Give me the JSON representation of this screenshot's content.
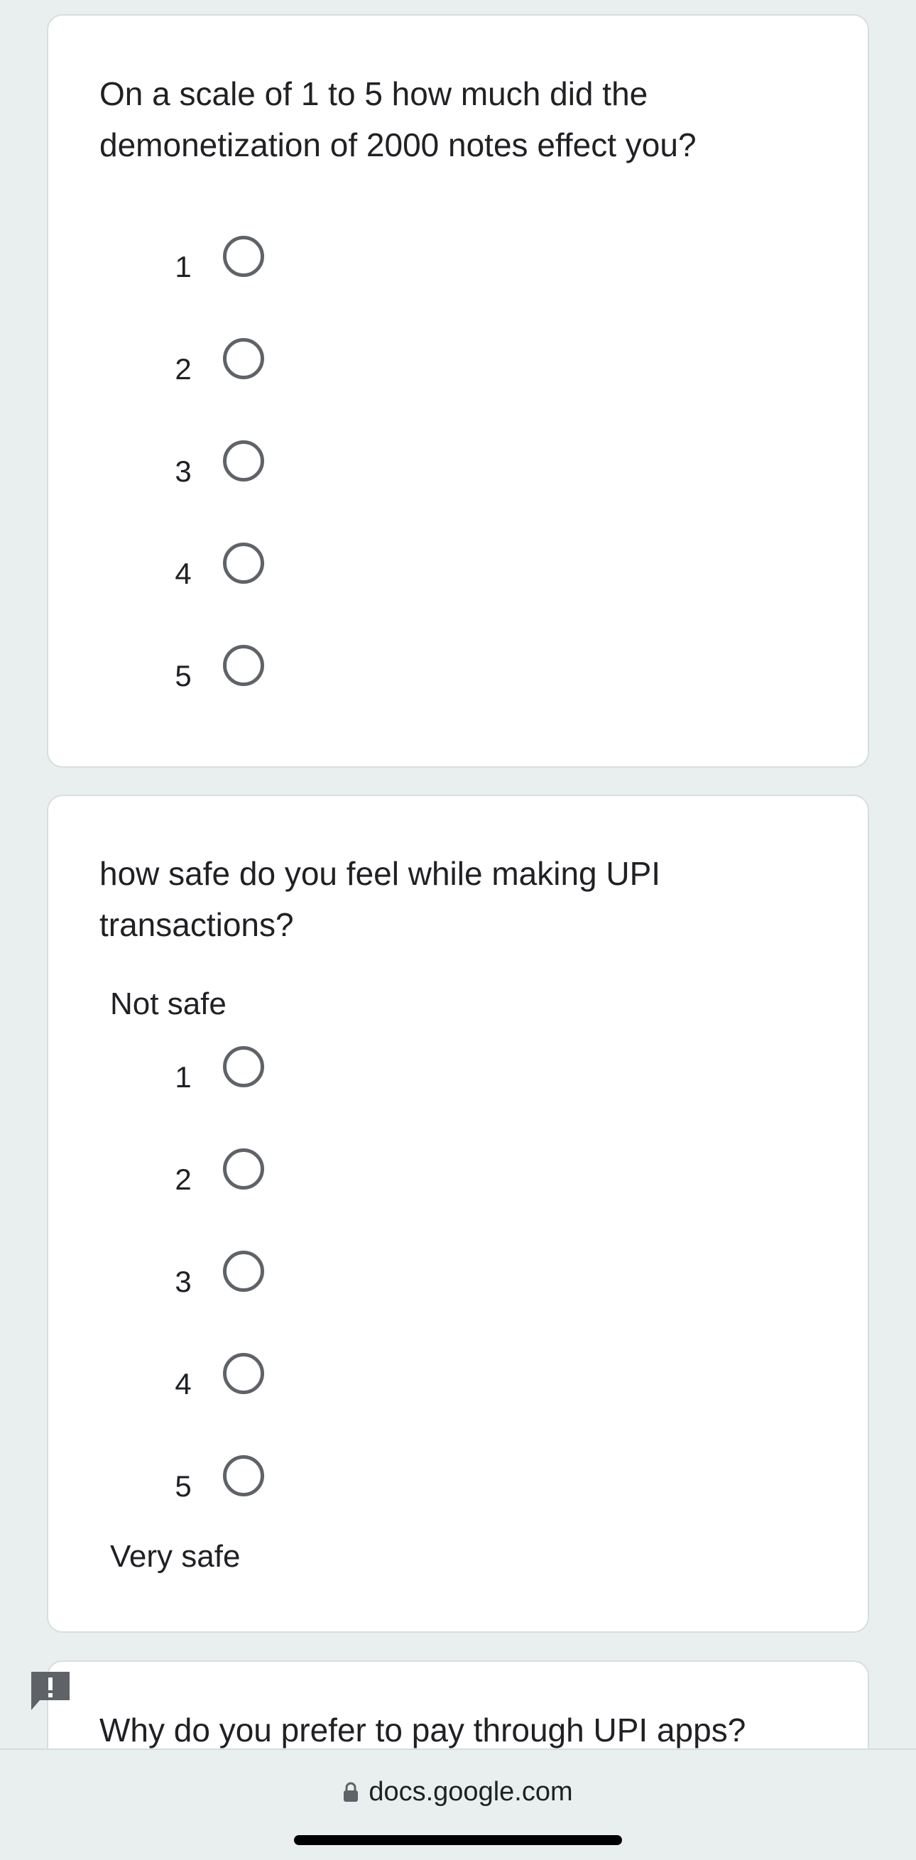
{
  "questions": [
    {
      "text": "On a scale of 1 to 5 how much did the demonetization of 2000 notes effect you?",
      "options": [
        "1",
        "2",
        "3",
        "4",
        "5"
      ]
    },
    {
      "text": "how safe do you feel while making UPI transactions?",
      "low_label": "Not safe",
      "high_label": "Very safe",
      "options": [
        "1",
        "2",
        "3",
        "4",
        "5"
      ]
    },
    {
      "text": "Why do you prefer to pay through UPI apps?"
    }
  ],
  "browser": {
    "url": "docs.google.com"
  },
  "icons": {
    "feedback": "report-feedback-icon",
    "lock": "lock-icon"
  },
  "colors": {
    "background": "#e8efee",
    "card": "#ffffff",
    "radio_border": "#5f6368"
  }
}
